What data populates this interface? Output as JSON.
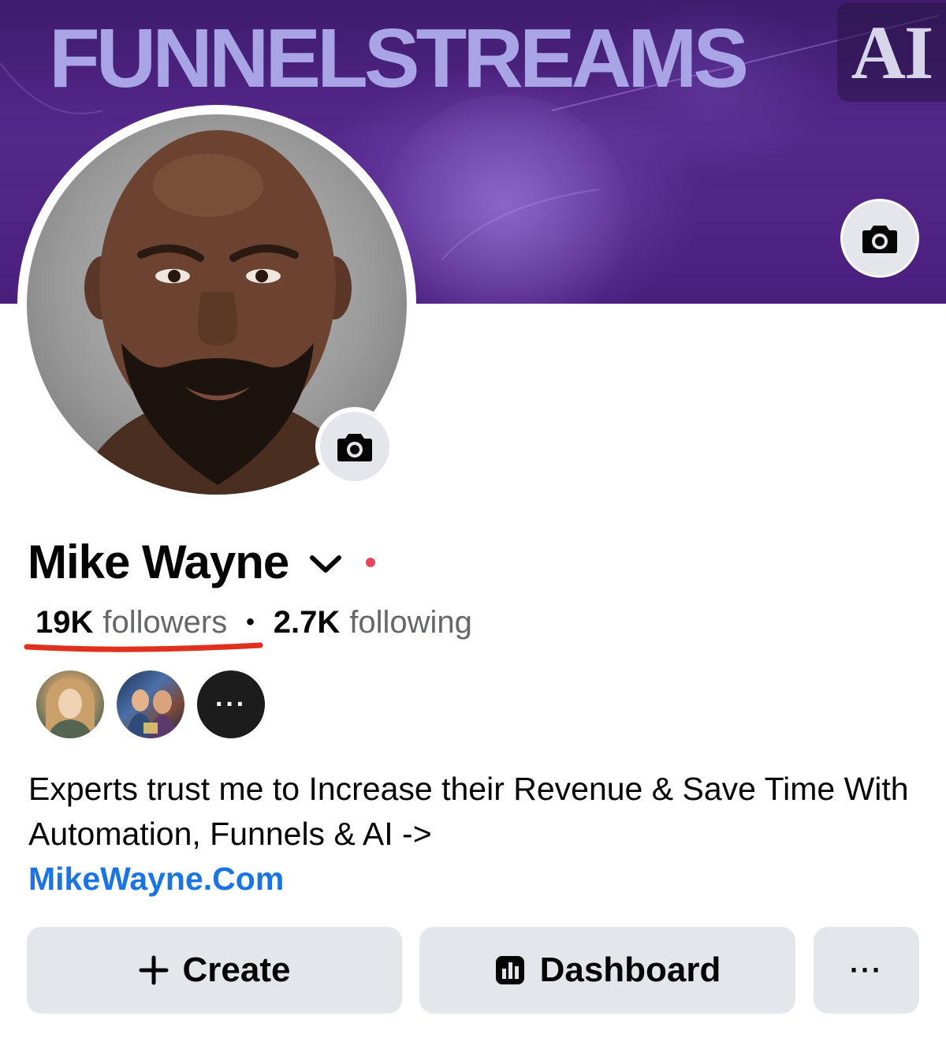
{
  "cover": {
    "title": "FUNNELSTREAMS",
    "title_suffix": "AI"
  },
  "profile": {
    "name": "Mike Wayne",
    "followers_count": "19K",
    "followers_label": "followers",
    "following_count": "2.7K",
    "following_label": "following",
    "separator": "•"
  },
  "friends": {
    "more_label": "···"
  },
  "bio": {
    "text": "Experts trust me to Increase their Revenue & Save Time With Automation, Funnels & AI ->",
    "link": "MikeWayne.Com"
  },
  "actions": {
    "create_label": "Create",
    "create_icon": "+",
    "dashboard_label": "Dashboard",
    "more_label": "···"
  },
  "colors": {
    "link": "#1b74e4",
    "button_bg": "#e4e6eb",
    "annotation_underline": "#e0301e",
    "status_dot": "#e4475a"
  },
  "icons": [
    "camera-icon",
    "chevron-down-icon",
    "plus-icon",
    "dashboard-icon",
    "more-icon"
  ]
}
